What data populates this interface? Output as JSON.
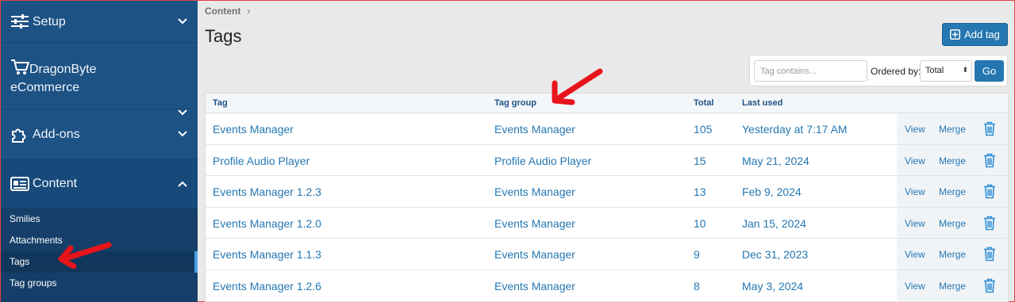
{
  "sidebar": {
    "sections": [
      {
        "label": "Setup",
        "icon": "sliders-icon"
      },
      {
        "label": "DragonByte eCommerce",
        "icon": "cart-icon"
      },
      {
        "label": "Add-ons",
        "icon": "puzzle-icon"
      },
      {
        "label": "Content",
        "icon": "newspaper-icon"
      }
    ],
    "subitems": [
      "Smilies",
      "Attachments",
      "Tags",
      "Tag groups"
    ],
    "active_subitem": "Tags"
  },
  "breadcrumb": {
    "label": "Content",
    "sep": "›"
  },
  "page": {
    "title": "Tags",
    "add_button": "Add tag"
  },
  "filter": {
    "placeholder": "Tag contains...",
    "ordered_by_label": "Ordered by:",
    "order_value": "Total",
    "go_label": "Go"
  },
  "table": {
    "headers": {
      "tag": "Tag",
      "group": "Tag group",
      "total": "Total",
      "last_used": "Last used"
    },
    "rows": [
      {
        "tag": "Events Manager",
        "group": "Events Manager",
        "total": "105",
        "last_used": "Yesterday at 7:17 AM",
        "view": "View",
        "merge": "Merge"
      },
      {
        "tag": "Profile Audio Player",
        "group": "Profile Audio Player",
        "total": "15",
        "last_used": "May 21, 2024",
        "view": "View",
        "merge": "Merge"
      },
      {
        "tag": "Events Manager 1.2.3",
        "group": "Events Manager",
        "total": "13",
        "last_used": "Feb 9, 2024",
        "view": "View",
        "merge": "Merge"
      },
      {
        "tag": "Events Manager 1.2.0",
        "group": "Events Manager",
        "total": "10",
        "last_used": "Jan 15, 2024",
        "view": "View",
        "merge": "Merge"
      },
      {
        "tag": "Events Manager 1.1.3",
        "group": "Events Manager",
        "total": "9",
        "last_used": "Dec 31, 2023",
        "view": "View",
        "merge": "Merge"
      },
      {
        "tag": "Events Manager 1.2.6",
        "group": "Events Manager",
        "total": "8",
        "last_used": "May 3, 2024",
        "view": "View",
        "merge": "Merge"
      }
    ]
  },
  "colors": {
    "sidebar": "#1d5285",
    "accent": "#2577b1",
    "annotation_arrow": "#e8141b"
  }
}
